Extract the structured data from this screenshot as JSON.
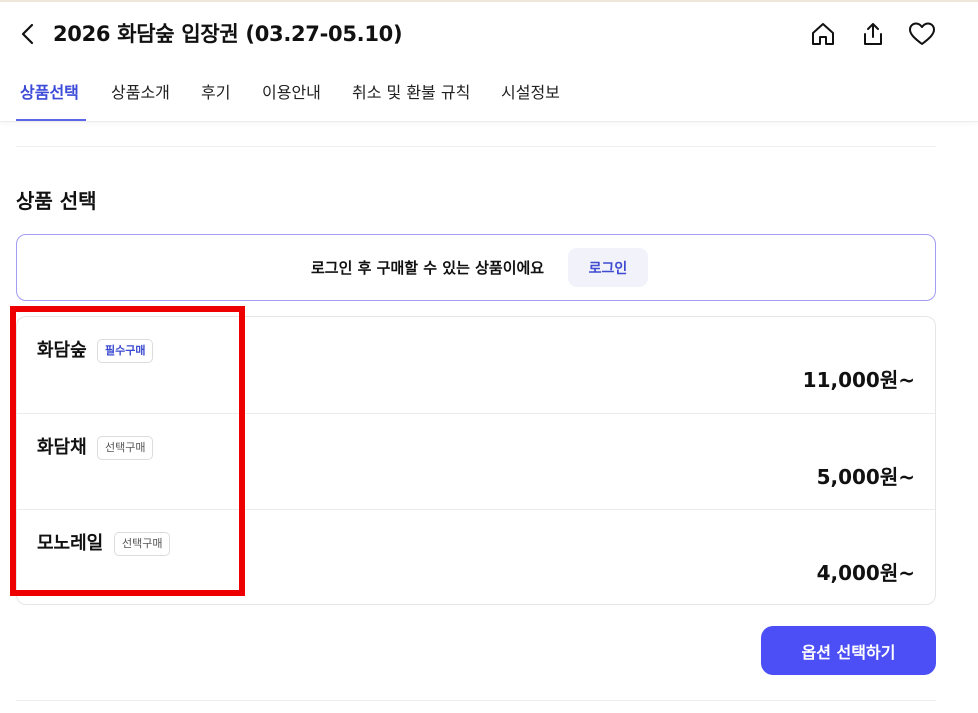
{
  "header": {
    "title": "2026 화담숲 입장권 (03.27-05.10)",
    "icons": [
      "back-arrow-icon",
      "home-icon",
      "share-icon",
      "heart-icon"
    ]
  },
  "tabs": [
    {
      "label": "상품선택",
      "active": true
    },
    {
      "label": "상품소개",
      "active": false
    },
    {
      "label": "후기",
      "active": false
    },
    {
      "label": "이용안내",
      "active": false
    },
    {
      "label": "취소 및 환불 규칙",
      "active": false
    },
    {
      "label": "시설정보",
      "active": false
    }
  ],
  "section": {
    "title": "상품 선택"
  },
  "login_notice": {
    "text": "로그인 후 구매할 수 있는 상품이에요",
    "button": "로그인"
  },
  "products": [
    {
      "name": "화담숲",
      "badge": "필수구매",
      "price": "11,000원~"
    },
    {
      "name": "화담채",
      "badge": "선택구매",
      "price": "5,000원~"
    },
    {
      "name": "모노레일",
      "badge": "선택구매",
      "price": "4,000원~"
    }
  ],
  "actions": {
    "option_button": "옵션 선택하기"
  },
  "colors": {
    "accent": "#3c4bd8",
    "button_primary": "#4b4ff5",
    "highlight_box": "#ee0000"
  }
}
